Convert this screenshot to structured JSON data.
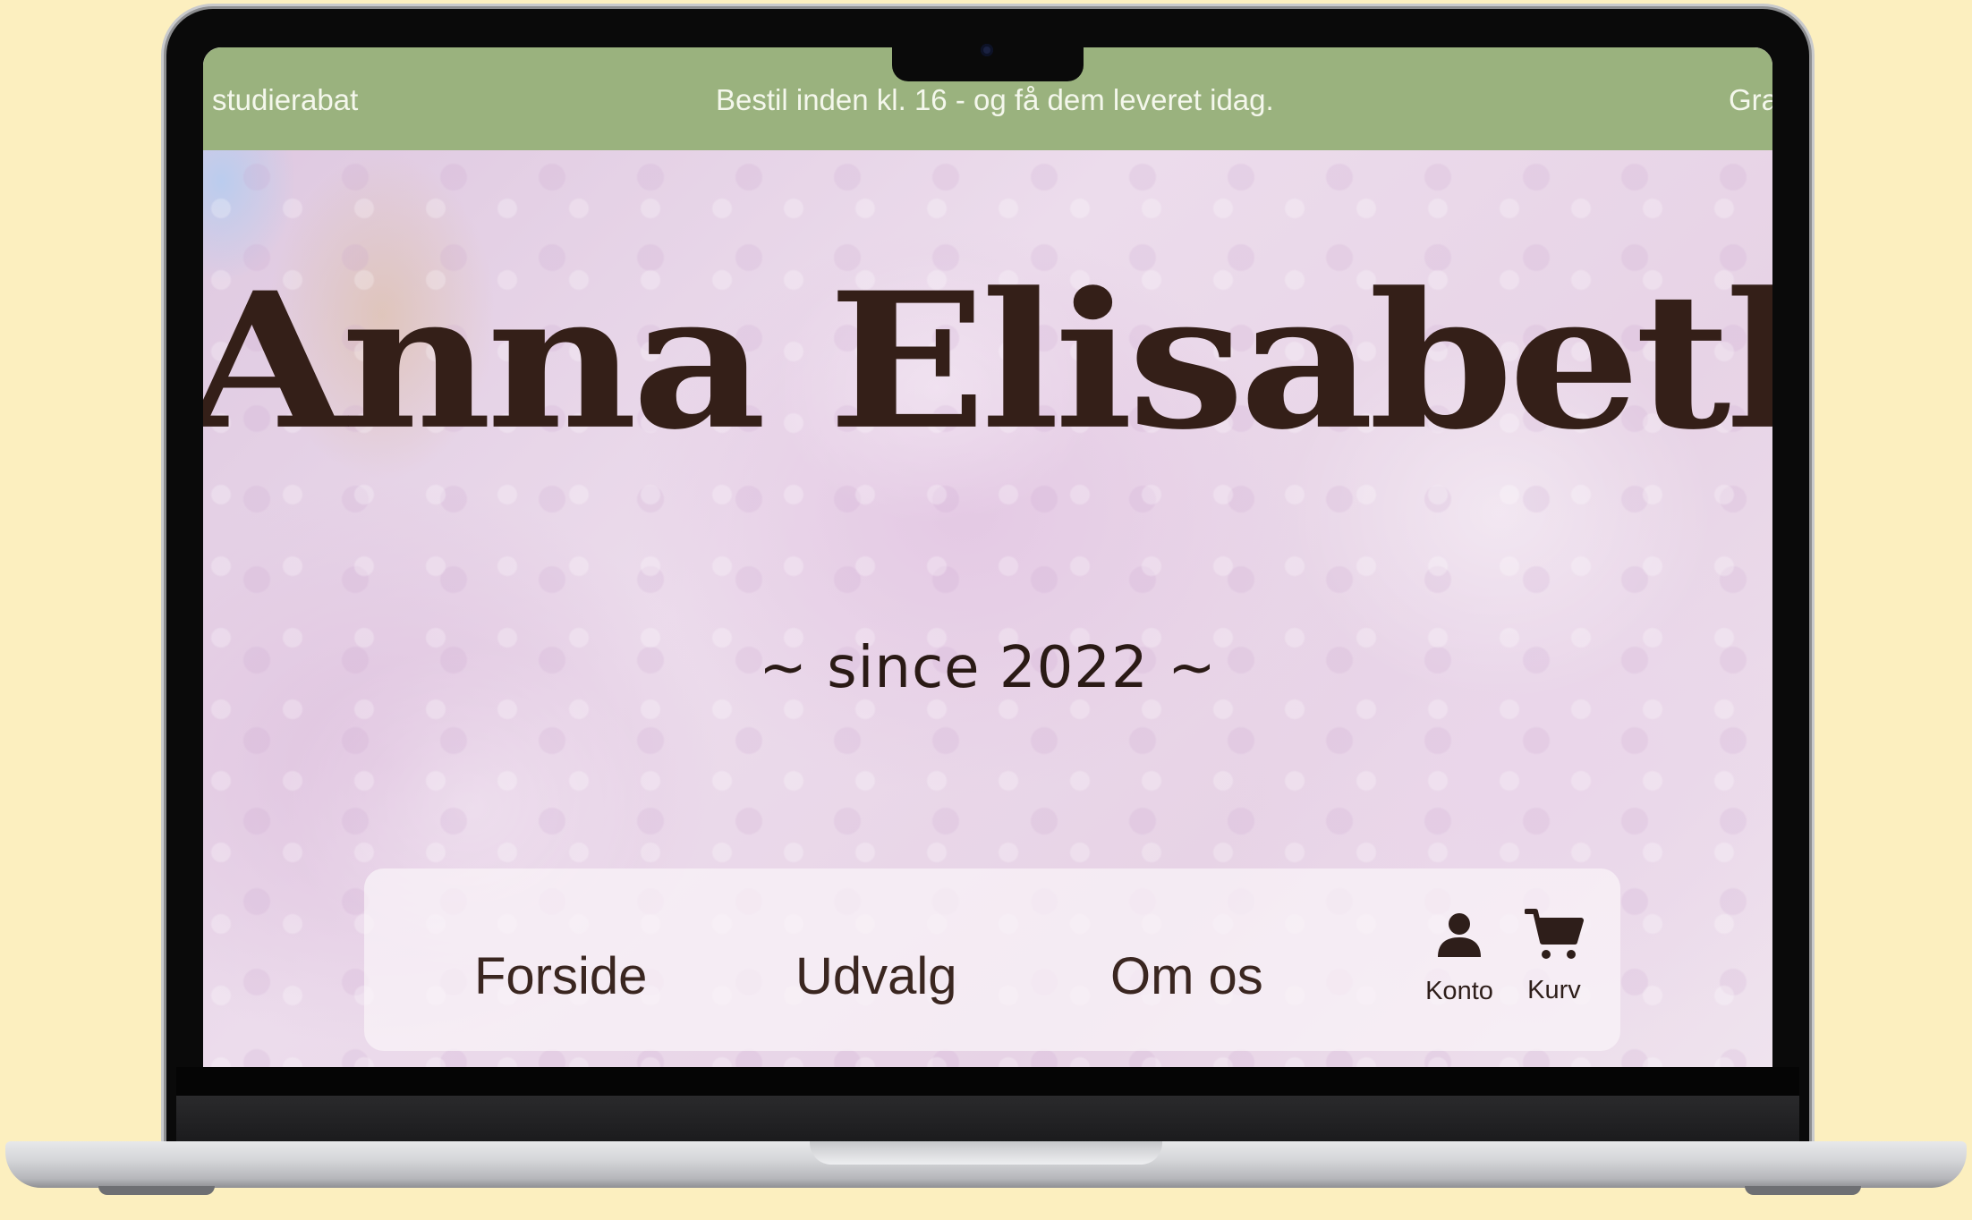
{
  "ticker": {
    "left": "studierabat",
    "center": "Bestil inden kl. 16 - og få dem leveret idag.",
    "right": "Gra"
  },
  "brand": {
    "name": "Anna Elisabeth",
    "tagline": "~ since 2022 ~"
  },
  "nav": {
    "items": [
      {
        "label": "Forside"
      },
      {
        "label": "Udvalg"
      },
      {
        "label": "Om os"
      }
    ],
    "account_label": "Konto",
    "cart_label": "Kurv",
    "account_icon": "user-icon",
    "cart_icon": "cart-icon"
  },
  "colors": {
    "ticker_bg": "#9ab27e",
    "ticker_text": "#f4f7ec",
    "brand_text": "#341f18",
    "background": "#fcefbf"
  }
}
